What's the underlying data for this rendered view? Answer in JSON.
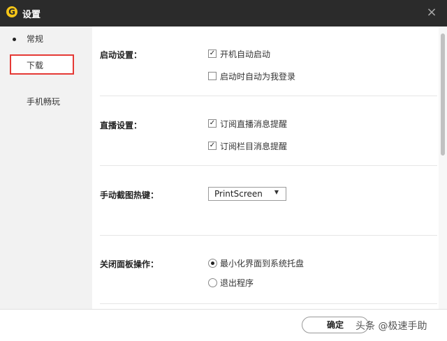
{
  "window": {
    "title": "设置",
    "logo_letter": "G",
    "close_glyph": "×"
  },
  "sidebar": {
    "items": [
      {
        "label": "常规"
      },
      {
        "label": "下载"
      },
      {
        "label": "手机畅玩"
      }
    ]
  },
  "sections": {
    "startup": {
      "label": "启动设置：",
      "options": [
        {
          "label": "开机自动启动",
          "checked": true
        },
        {
          "label": "启动时自动为我登录",
          "checked": false
        }
      ]
    },
    "live": {
      "label": "直播设置：",
      "options": [
        {
          "label": "订阅直播消息提醒",
          "checked": true
        },
        {
          "label": "订阅栏目消息提醒",
          "checked": true
        }
      ]
    },
    "hotkey": {
      "label": "手动截图热键：",
      "value": "PrintScreen",
      "arrow": "▼"
    },
    "close_panel": {
      "label": "关闭面板操作：",
      "options": [
        {
          "label": "最小化界面到系统托盘",
          "selected": true
        },
        {
          "label": "退出程序",
          "selected": false
        }
      ]
    }
  },
  "footer": {
    "ok_label": "确定",
    "watermark": "头条 @极速手助"
  },
  "checkmark": "✓",
  "colors": {
    "titlebar": "#2b2b2b",
    "logo": "#f5c518",
    "highlight": "#e53935",
    "sidebar": "#f2f2f2"
  }
}
